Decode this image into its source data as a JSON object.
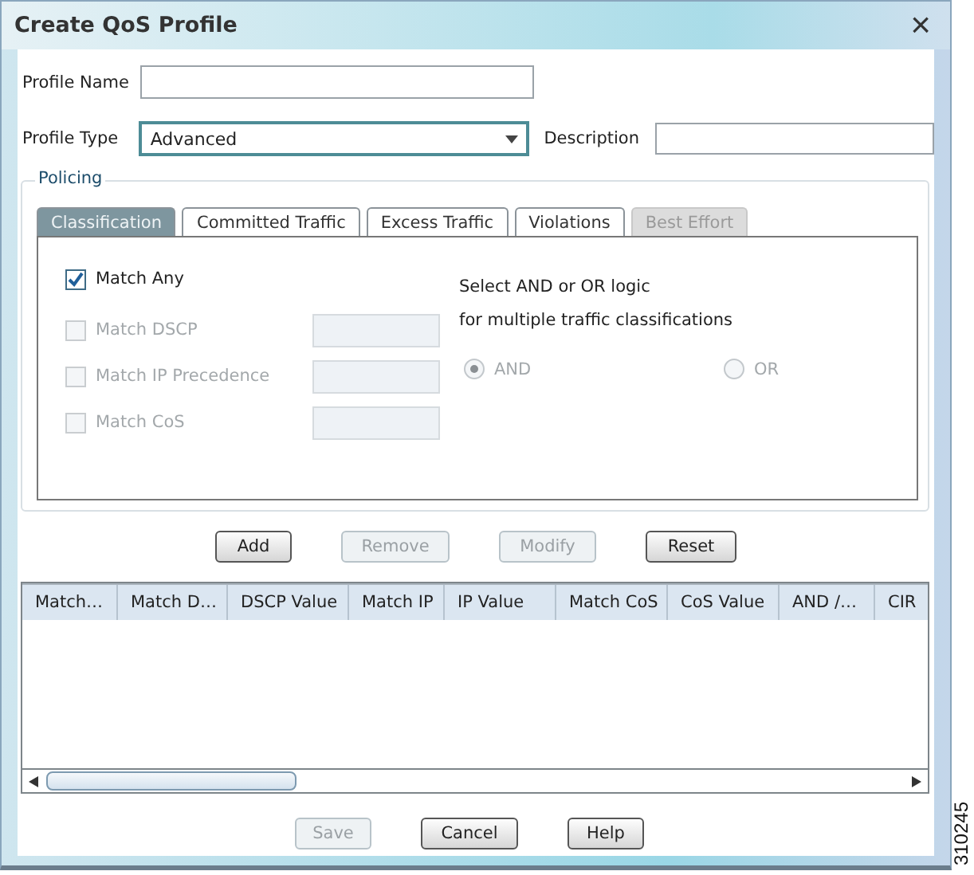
{
  "window": {
    "title": "Create QoS Profile",
    "close": "×"
  },
  "profile_name": {
    "label": "Profile Name"
  },
  "profile_type": {
    "label": "Profile Type",
    "value": "Advanced"
  },
  "description": {
    "label": "Description"
  },
  "policing": {
    "legend": "Policing",
    "tabs": [
      {
        "label": "Classification",
        "selected": true,
        "disabled": false
      },
      {
        "label": "Committed Traffic",
        "selected": false,
        "disabled": false
      },
      {
        "label": "Excess Traffic",
        "selected": false,
        "disabled": false
      },
      {
        "label": "Violations",
        "selected": false,
        "disabled": false
      },
      {
        "label": "Best Effort",
        "selected": false,
        "disabled": true
      }
    ],
    "matches": [
      {
        "kind": "checkbox",
        "label": "Match Any",
        "checked": true,
        "disabled": false
      },
      {
        "kind": "checkbox-field",
        "label": "Match DSCP",
        "checked": false,
        "disabled": true
      },
      {
        "kind": "checkbox-field",
        "label": "Match IP Precedence",
        "checked": false,
        "disabled": true
      },
      {
        "kind": "checkbox-field",
        "label": "Match CoS",
        "checked": false,
        "disabled": true
      }
    ],
    "logic_hint": [
      "Select AND or OR logic",
      "for multiple traffic classifications"
    ],
    "logic": [
      {
        "label": "AND",
        "selected": true,
        "disabled": true
      },
      {
        "label": "OR",
        "selected": false,
        "disabled": true
      }
    ]
  },
  "actions": [
    {
      "label": "Add",
      "disabled": false
    },
    {
      "label": "Remove",
      "disabled": true
    },
    {
      "label": "Modify",
      "disabled": true
    },
    {
      "label": "Reset",
      "disabled": false
    }
  ],
  "table": {
    "columns": [
      "Match…",
      "Match D…",
      "DSCP Value",
      "Match IP",
      "IP Value",
      "Match CoS",
      "CoS Value",
      "AND /…",
      "CIR"
    ]
  },
  "footer_buttons": [
    {
      "label": "Save",
      "disabled": true
    },
    {
      "label": "Cancel",
      "disabled": false
    },
    {
      "label": "Help",
      "disabled": false
    }
  ],
  "figure_id": "310245"
}
